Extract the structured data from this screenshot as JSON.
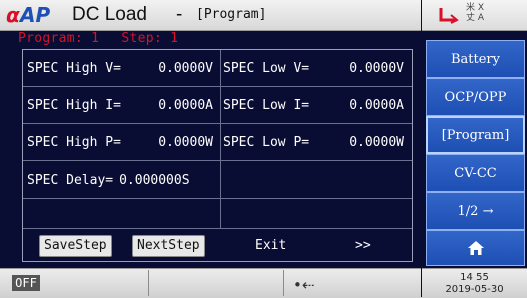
{
  "header": {
    "app_title": "DC Load",
    "separator": "-",
    "mode": "[Program]",
    "language_icon": "language-icon",
    "lan_icon": "lan-icon",
    "lang_glyphs_top": "X",
    "lang_glyphs_bottom": "A"
  },
  "status": {
    "program": "Program: 1",
    "step": "Step: 1"
  },
  "table": {
    "rows": [
      {
        "left_label": "SPEC High V=",
        "left_value": "0.0000V",
        "right_label": "SPEC Low V=",
        "right_value": "0.0000V"
      },
      {
        "left_label": "SPEC High I=",
        "left_value": "0.0000A",
        "right_label": "SPEC Low I=",
        "right_value": "0.0000A"
      },
      {
        "left_label": "SPEC High P=",
        "left_value": "0.0000W",
        "right_label": "SPEC Low P=",
        "right_value": "0.0000W"
      }
    ],
    "delay_label": "SPEC Delay=",
    "delay_value": "0.000000S"
  },
  "footer": {
    "save_step": "SaveStep",
    "next_step": "NextStep",
    "exit": "Exit",
    "more": ">>"
  },
  "softkeys": [
    {
      "label": "Battery"
    },
    {
      "label": "OCP/OPP"
    },
    {
      "label": "[Program]"
    },
    {
      "label": "CV-CC"
    },
    {
      "label": "1/2  →"
    }
  ],
  "home_icon": "home-icon",
  "bottom": {
    "output_state": "OFF",
    "usb_icon": "usb-icon",
    "time": "14 55",
    "date": "2019-05-30"
  },
  "colors": {
    "background": "#0a0d33",
    "status_red": "#d8102a",
    "softkey_blue": "#2a5ac0"
  }
}
